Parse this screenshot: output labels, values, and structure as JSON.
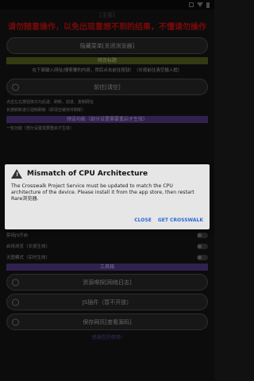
{
  "statusbar": {
    "icons": [
      "signal-icon",
      "wifi-icon",
      "battery-icon"
    ]
  },
  "topbar": {
    "title": "[主面]"
  },
  "warning_text": "请勿随意操作，以免出现意想不到的结果，不懂请勿操作",
  "pills": {
    "hide_menu": "隐藏菜单[关闭浏览器]",
    "url_input": "前往[请空]",
    "resource_sniff": "资源嗅探[网络日志]",
    "js_plugin": "JS插件（暂不开放）",
    "web_source": "保存网页[查看源码]"
  },
  "bars": {
    "web_title": "网页标题",
    "tools": "工具箱",
    "preset": "预设功能（部分设置需要重启才生效）"
  },
  "hint_url": "在下面输入网址/搜索要的内容，然后点击前往按钮！（长按前往清空输入框）",
  "hints": {
    "line1": "点击左右按钮依次为后退、刷新、前进、复制网址",
    "line2": "长按刷新进行强制刷新（即清空缓存并刷新）",
    "line3": "一些功能（部分设置需要重启才生效）"
  },
  "rows": {
    "r1": "禁用JS开启",
    "r2": "启用浏览（长按生效）",
    "r3": "无图模式（实时生效）"
  },
  "link": "感谢您的使用!",
  "dialog": {
    "title": "Mismatch of CPU Architecture",
    "message": "The Crosswalk Project Service must be updated to match the CPU architecture of the device. Please install it from the app store, then restart Rare浏览器.",
    "close": "CLOSE",
    "get": "GET CROSSWALK"
  },
  "colors": {
    "warning": "#dd1111",
    "olive": "#5f6a1f",
    "purple": "#5a3d90",
    "accent": "#2a6bd4"
  }
}
